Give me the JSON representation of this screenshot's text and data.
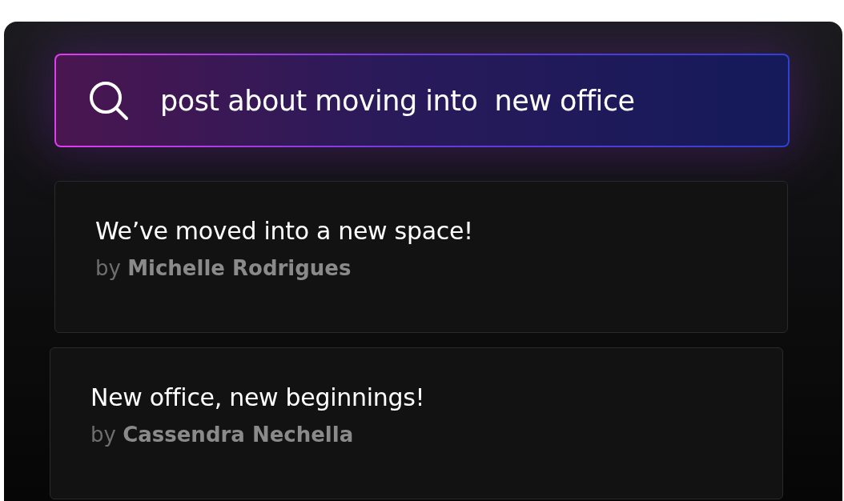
{
  "search": {
    "value": "post about moving into  new office"
  },
  "results": [
    {
      "title": "We’ve moved into a new space!",
      "byline": "by **Michelle Rodrigues**"
    },
    {
      "title": "New office, new beginnings!",
      "byline": "by **Cassendra Nechella**"
    }
  ]
}
